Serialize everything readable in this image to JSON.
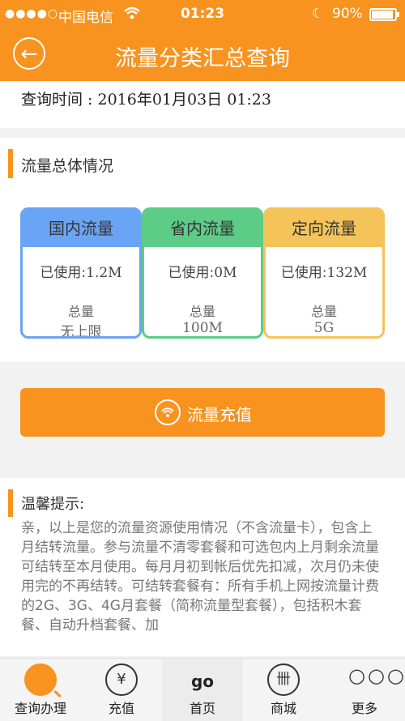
{
  "status_bar": {
    "signal": "●●●●○",
    "carrier": "中国电信",
    "time": "01:23",
    "battery": "90%"
  },
  "header": {
    "title": "流量分类汇总查询"
  },
  "query": {
    "time_text": "查询时间 : 2016年01月03日 01:23"
  },
  "overview": {
    "title": "流量总体情况",
    "cards": [
      {
        "name": "国内流量",
        "used_label": "已使用:",
        "used_value": "1.2M",
        "total_label": "总量",
        "total_value": "无上限",
        "color": "#6aa4f4"
      },
      {
        "name": "省内流量",
        "used_label": "已使用:",
        "used_value": "0M",
        "total_label": "总量",
        "total_value": "100M",
        "color": "#5ccc86"
      },
      {
        "name": "定向流量",
        "used_label": "已使用:",
        "used_value": "132M",
        "total_label": "总量",
        "total_value": "5G",
        "color": "#f4c35a"
      }
    ]
  },
  "recharge": {
    "label": "流量充值"
  },
  "tips": {
    "title": "温馨提示:",
    "body": "亲，以上是您的流量资源使用情况（不含流量卡），包含上月结转流量。参与流量不清零套餐和可选包内上月剩余流量可结转至本月使用。每月月初到帐后优先扣减，次月仍未使用完的不再结转。可结转套餐有：所有手机上网按流量计费的2G、3G、4G月套餐（简称流量型套餐），包括积木套餐、自动升档套餐、加"
  },
  "tabbar": {
    "items": [
      {
        "label": "查询办理",
        "icon": "search-icon"
      },
      {
        "label": "充值",
        "icon": "yuan-icon"
      },
      {
        "label": "首页",
        "logo_text": "go"
      },
      {
        "label": "商城",
        "icon": "shop-icon"
      },
      {
        "label": "更多",
        "icon": "more-icon"
      }
    ]
  },
  "colors": {
    "accent": "#f7931e"
  }
}
